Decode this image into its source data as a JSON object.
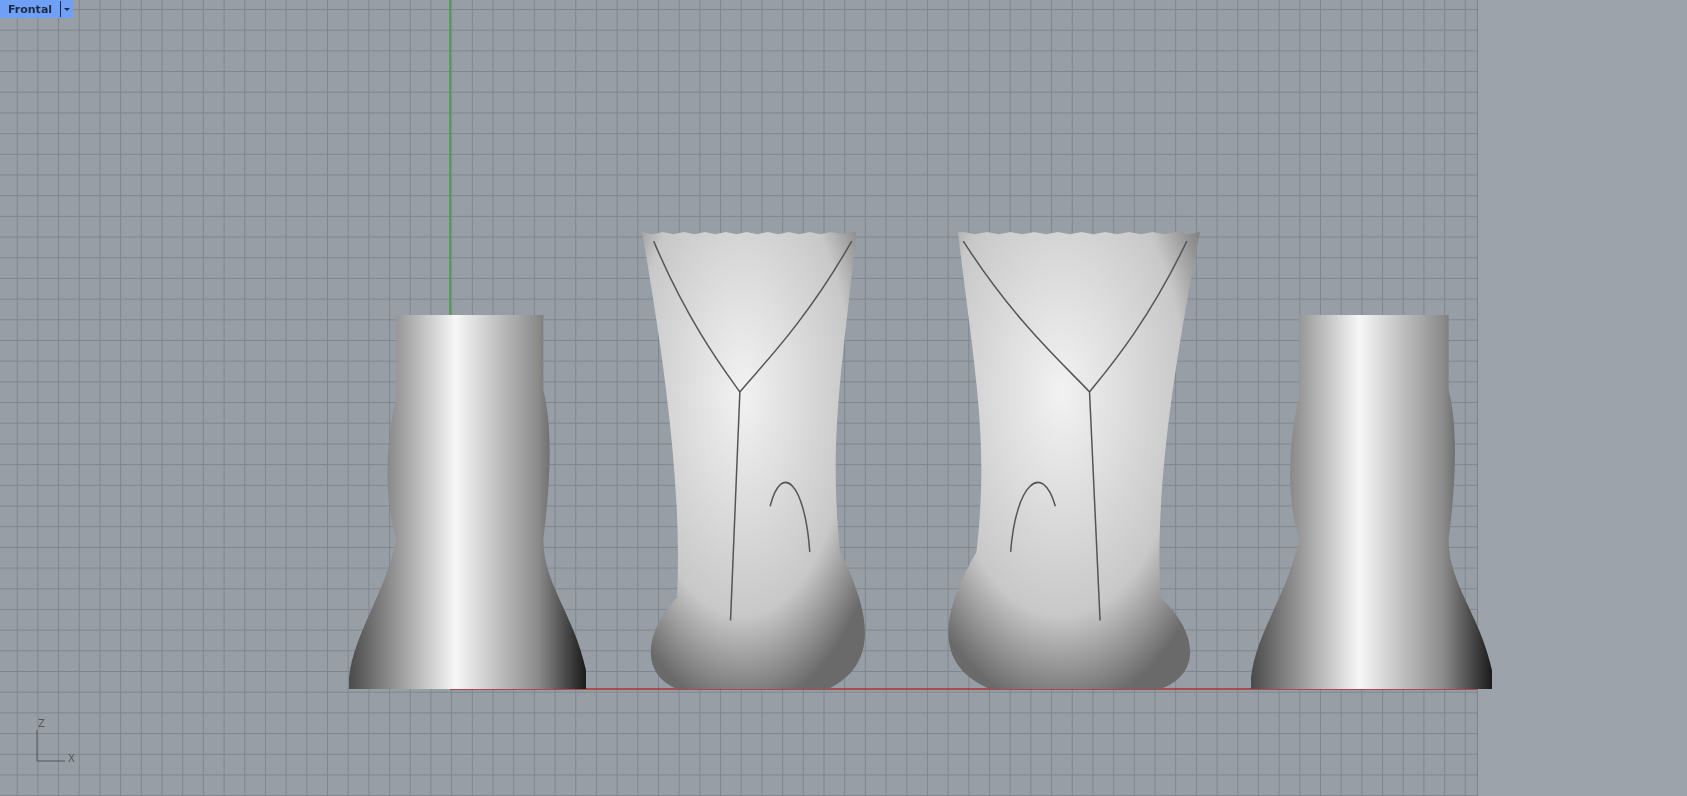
{
  "viewport": {
    "label": "Frontal"
  },
  "axis_labels": [
    "Z",
    "X"
  ]
}
